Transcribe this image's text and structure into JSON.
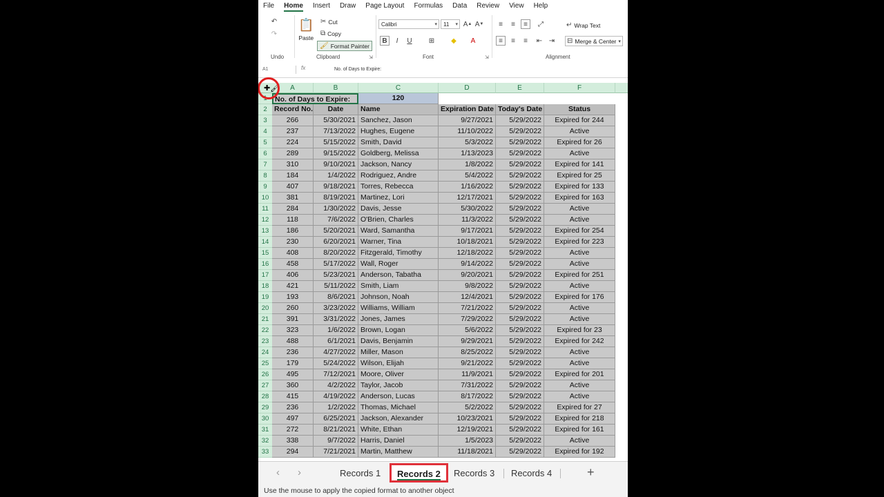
{
  "menu": [
    "File",
    "Home",
    "Insert",
    "Draw",
    "Page Layout",
    "Formulas",
    "Data",
    "Review",
    "View",
    "Help"
  ],
  "menu_active": "Home",
  "ribbon": {
    "undo_group": "Undo",
    "clipboard": {
      "paste": "Paste",
      "cut": "Cut",
      "copy": "Copy",
      "format_painter": "Format Painter",
      "label": "Clipboard"
    },
    "font": {
      "name": "Calibri",
      "size": "11",
      "label": "Font"
    },
    "alignment": {
      "wrap": "Wrap Text",
      "merge": "Merge & Center",
      "label": "Alignment"
    }
  },
  "formula_bar": {
    "name_box": "A1",
    "fx": "fx",
    "content": "No. of Days to Expire:"
  },
  "columns": [
    "A",
    "B",
    "C",
    "D",
    "E",
    "F"
  ],
  "row1": {
    "label": "No. of Days to Expire:",
    "value": "120"
  },
  "headers": [
    "Record No.",
    "Date",
    "Name",
    "Expiration Date",
    "Today's Date",
    "Status"
  ],
  "rows": [
    [
      "266",
      "5/30/2021",
      "Sanchez, Jason",
      "9/27/2021",
      "5/29/2022",
      "Expired for 244"
    ],
    [
      "237",
      "7/13/2022",
      "Hughes, Eugene",
      "11/10/2022",
      "5/29/2022",
      "Active"
    ],
    [
      "224",
      "5/15/2022",
      "Smith, David",
      "5/3/2022",
      "5/29/2022",
      "Expired for 26"
    ],
    [
      "289",
      "9/15/2022",
      "Goldberg, Melissa",
      "1/13/2023",
      "5/29/2022",
      "Active"
    ],
    [
      "310",
      "9/10/2021",
      "Jackson, Nancy",
      "1/8/2022",
      "5/29/2022",
      "Expired for 141"
    ],
    [
      "184",
      "1/4/2022",
      "Rodriguez, Andre",
      "5/4/2022",
      "5/29/2022",
      "Expired for 25"
    ],
    [
      "407",
      "9/18/2021",
      "Torres, Rebecca",
      "1/16/2022",
      "5/29/2022",
      "Expired for 133"
    ],
    [
      "381",
      "8/19/2021",
      "Martinez, Lori",
      "12/17/2021",
      "5/29/2022",
      "Expired for 163"
    ],
    [
      "284",
      "1/30/2022",
      "Davis, Jesse",
      "5/30/2022",
      "5/29/2022",
      "Active"
    ],
    [
      "118",
      "7/6/2022",
      "O'Brien, Charles",
      "11/3/2022",
      "5/29/2022",
      "Active"
    ],
    [
      "186",
      "5/20/2021",
      "Ward, Samantha",
      "9/17/2021",
      "5/29/2022",
      "Expired for 254"
    ],
    [
      "230",
      "6/20/2021",
      "Warner, Tina",
      "10/18/2021",
      "5/29/2022",
      "Expired for 223"
    ],
    [
      "408",
      "8/20/2022",
      "Fitzgerald, Timothy",
      "12/18/2022",
      "5/29/2022",
      "Active"
    ],
    [
      "458",
      "5/17/2022",
      "Wall, Roger",
      "9/14/2022",
      "5/29/2022",
      "Active"
    ],
    [
      "406",
      "5/23/2021",
      "Anderson, Tabatha",
      "9/20/2021",
      "5/29/2022",
      "Expired for 251"
    ],
    [
      "421",
      "5/11/2022",
      "Smith, Liam",
      "9/8/2022",
      "5/29/2022",
      "Active"
    ],
    [
      "193",
      "8/6/2021",
      "Johnson, Noah",
      "12/4/2021",
      "5/29/2022",
      "Expired for 176"
    ],
    [
      "260",
      "3/23/2022",
      "Williams, William",
      "7/21/2022",
      "5/29/2022",
      "Active"
    ],
    [
      "391",
      "3/31/2022",
      "Jones, James",
      "7/29/2022",
      "5/29/2022",
      "Active"
    ],
    [
      "323",
      "1/6/2022",
      "Brown, Logan",
      "5/6/2022",
      "5/29/2022",
      "Expired for 23"
    ],
    [
      "488",
      "6/1/2021",
      "Davis, Benjamin",
      "9/29/2021",
      "5/29/2022",
      "Expired for 242"
    ],
    [
      "236",
      "4/27/2022",
      "Miller, Mason",
      "8/25/2022",
      "5/29/2022",
      "Active"
    ],
    [
      "179",
      "5/24/2022",
      "Wilson, Elijah",
      "9/21/2022",
      "5/29/2022",
      "Active"
    ],
    [
      "495",
      "7/12/2021",
      "Moore, Oliver",
      "11/9/2021",
      "5/29/2022",
      "Expired for 201"
    ],
    [
      "360",
      "4/2/2022",
      "Taylor, Jacob",
      "7/31/2022",
      "5/29/2022",
      "Active"
    ],
    [
      "415",
      "4/19/2022",
      "Anderson, Lucas",
      "8/17/2022",
      "5/29/2022",
      "Active"
    ],
    [
      "236",
      "1/2/2022",
      "Thomas, Michael",
      "5/2/2022",
      "5/29/2022",
      "Expired for 27"
    ],
    [
      "497",
      "6/25/2021",
      "Jackson, Alexander",
      "10/23/2021",
      "5/29/2022",
      "Expired for 218"
    ],
    [
      "272",
      "8/21/2021",
      "White, Ethan",
      "12/19/2021",
      "5/29/2022",
      "Expired for 161"
    ],
    [
      "338",
      "9/7/2022",
      "Harris, Daniel",
      "1/5/2023",
      "5/29/2022",
      "Active"
    ],
    [
      "294",
      "7/21/2021",
      "Martin, Matthew",
      "11/18/2021",
      "5/29/2022",
      "Expired for 192"
    ]
  ],
  "sheet_tabs": [
    "Records 1",
    "Records 2",
    "Records 3",
    "Records 4"
  ],
  "active_sheet": "Records 2",
  "status_text": "Use the mouse to apply the copied format to another object",
  "colors": {
    "accent": "#217346",
    "highlight": "#e0313a"
  }
}
